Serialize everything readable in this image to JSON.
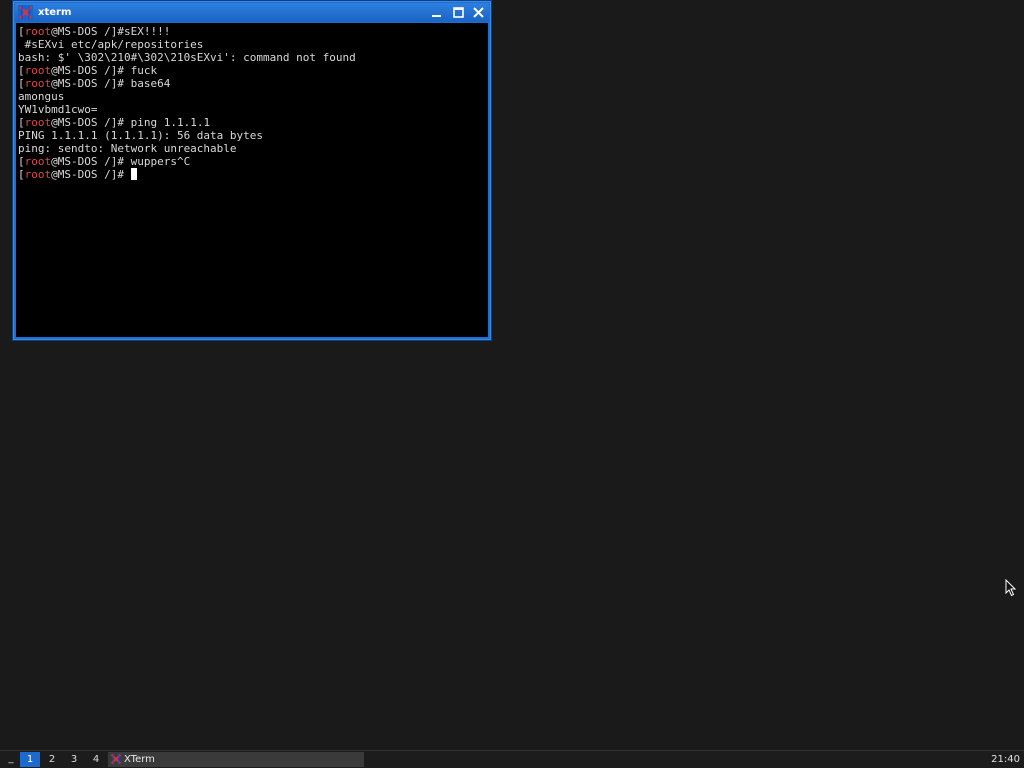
{
  "window": {
    "title": "xterm",
    "app_icon": "xterm-x-icon",
    "controls": [
      "minimize-icon",
      "maximize-icon",
      "close-icon"
    ]
  },
  "terminal": {
    "lines": [
      {
        "prompt": true,
        "text": "#sEX!!!!"
      },
      {
        "prompt": false,
        "text": " #sEXvi etc/apk/repositories"
      },
      {
        "prompt": false,
        "text": "bash: $' \\302\\210#\\302\\210sEXvi': command not found"
      },
      {
        "prompt": true,
        "text": "# fuck"
      },
      {
        "prompt": true,
        "text": "# base64"
      },
      {
        "prompt": false,
        "text": "amongus"
      },
      {
        "prompt": false,
        "text": "YW1vbmd1cwo="
      },
      {
        "prompt": true,
        "text": "# ping 1.1.1.1"
      },
      {
        "prompt": false,
        "text": "PING 1.1.1.1 (1.1.1.1): 56 data bytes"
      },
      {
        "prompt": false,
        "text": "ping: sendto: Network unreachable"
      },
      {
        "prompt": true,
        "text": "# wuppers^C"
      },
      {
        "prompt": true,
        "text": "# ",
        "cursor": true
      }
    ],
    "prompt": {
      "open": "[",
      "user": "root",
      "host": "@MS-DOS /]"
    },
    "colors": {
      "background": "#000000",
      "text": "#d8d8d8",
      "user": "#e04545",
      "cursor": "#ffffff"
    }
  },
  "taskbar": {
    "menu_label": "_",
    "workspaces": [
      {
        "label": "1",
        "active": true
      },
      {
        "label": "2",
        "active": false
      },
      {
        "label": "3",
        "active": false
      },
      {
        "label": "4",
        "active": false
      }
    ],
    "tasks": [
      {
        "label": "XTerm",
        "icon": "xterm-x-icon"
      }
    ],
    "clock": "21:40",
    "accent": "#1c6ad0"
  }
}
